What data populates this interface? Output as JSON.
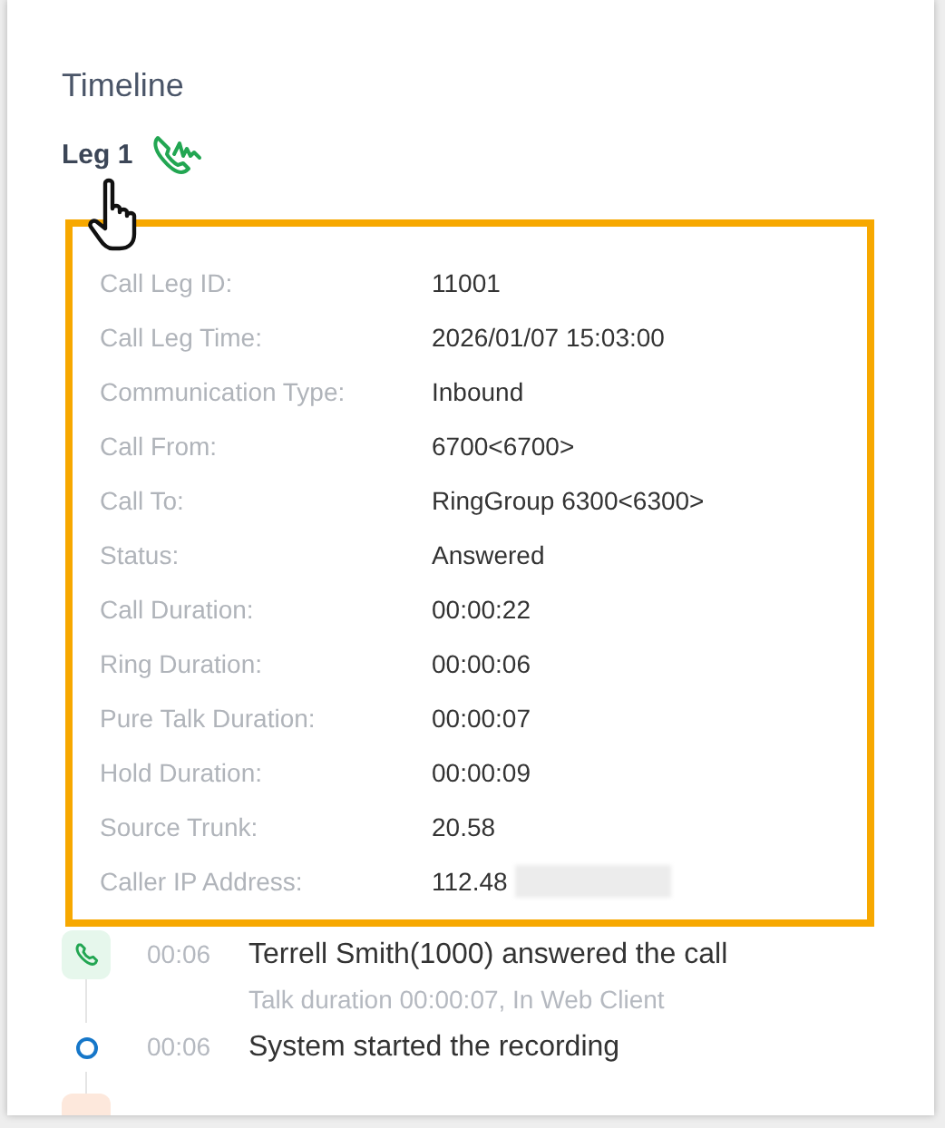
{
  "title": "Timeline",
  "leg": {
    "label": "Leg 1"
  },
  "details": [
    {
      "label": "Call Leg ID:",
      "value": "11001"
    },
    {
      "label": "Call Leg Time:",
      "value": "2026/01/07 15:03:00"
    },
    {
      "label": "Communication Type:",
      "value": "Inbound"
    },
    {
      "label": "Call From:",
      "value": "6700<6700>"
    },
    {
      "label": "Call To:",
      "value": "RingGroup 6300<6300>"
    },
    {
      "label": "Status:",
      "value": "Answered"
    },
    {
      "label": "Call Duration:",
      "value": "00:00:22"
    },
    {
      "label": "Ring Duration:",
      "value": "00:00:06"
    },
    {
      "label": "Pure Talk Duration:",
      "value": "00:00:07"
    },
    {
      "label": "Hold Duration:",
      "value": "00:00:09"
    },
    {
      "label": "Source Trunk:",
      "value": "20.58"
    },
    {
      "label": "Caller IP Address:",
      "value": "112.48",
      "redacted": true
    }
  ],
  "timeline": [
    {
      "kind": "call",
      "time": "00:06",
      "text": "Terrell Smith(1000) answered the call",
      "subtext": "Talk duration 00:00:07, In Web Client"
    },
    {
      "kind": "system",
      "time": "00:06",
      "text": "System started the recording"
    },
    {
      "kind": "alert"
    }
  ]
}
